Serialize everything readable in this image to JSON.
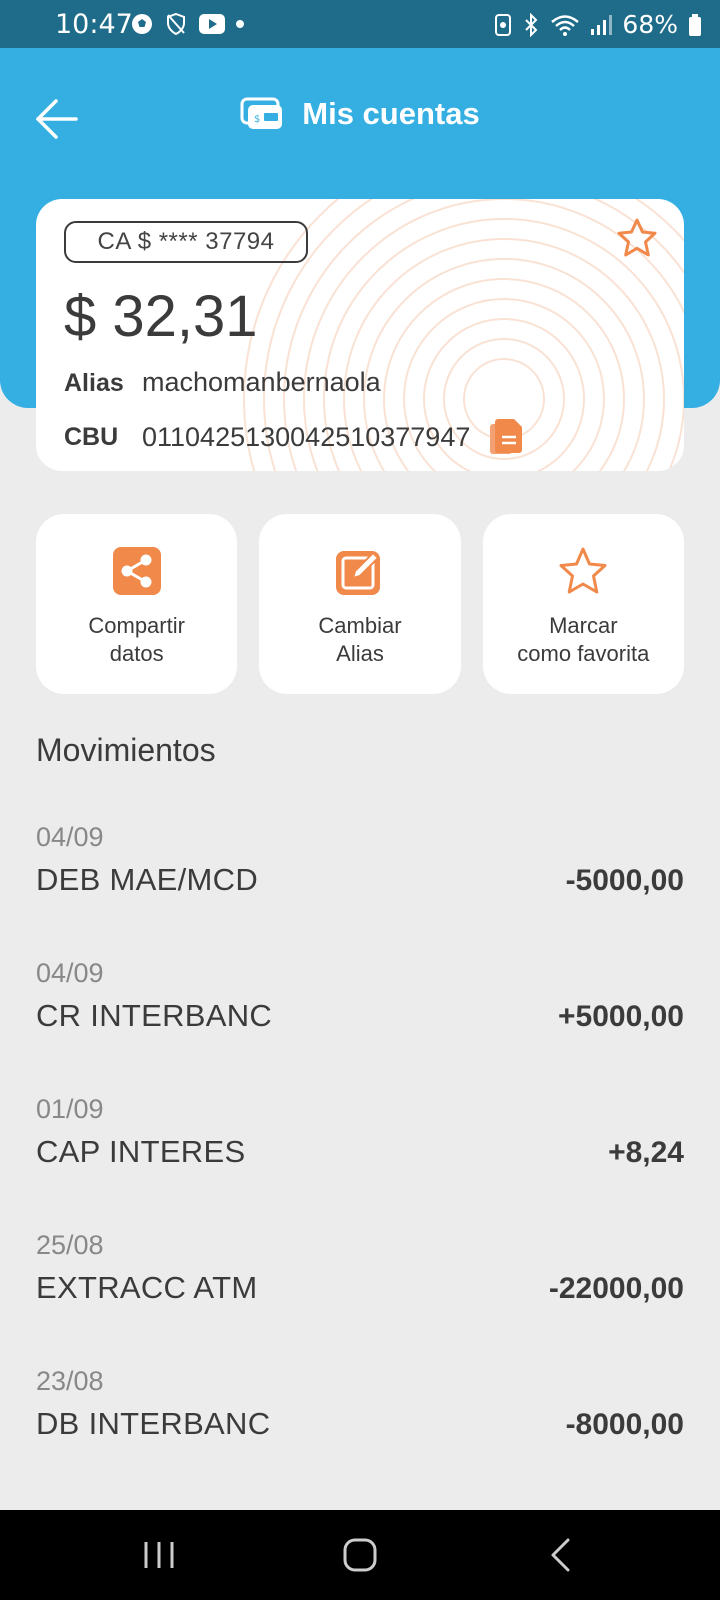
{
  "status_bar": {
    "time": "10:47",
    "battery": "68%",
    "left_icons": [
      "soccer-icon",
      "shield-icon",
      "youtube-icon",
      "dot-icon"
    ],
    "right_icons": [
      "nfc-icon",
      "bluetooth-icon",
      "wifi-icon",
      "signal-icon",
      "battery-icon"
    ]
  },
  "header": {
    "title": "Mis cuentas",
    "color": "#35afe2"
  },
  "account": {
    "number": "CA $ **** 37794",
    "balance": "$ 32,31",
    "alias_label": "Alias",
    "alias_value": "machomanbernaola",
    "cbu_label": "CBU",
    "cbu_value": "0110425130042510377947"
  },
  "actions": [
    {
      "label": "Compartir\ndatos",
      "icon": "share-icon"
    },
    {
      "label": "Cambiar\nAlias",
      "icon": "edit-icon"
    },
    {
      "label": "Marcar\ncomo favorita",
      "icon": "star-icon"
    }
  ],
  "accent_color": "#f0894a",
  "movements": {
    "title": "Movimientos",
    "items": [
      {
        "date": "04/09",
        "description": "DEB MAE/MCD",
        "amount": "-5000,00"
      },
      {
        "date": "04/09",
        "description": "CR INTERBANC",
        "amount": "+5000,00"
      },
      {
        "date": "01/09",
        "description": "CAP INTERES",
        "amount": "+8,24"
      },
      {
        "date": "25/08",
        "description": "EXTRACC ATM",
        "amount": "-22000,00"
      },
      {
        "date": "23/08",
        "description": "DB INTERBANC",
        "amount": "-8000,00"
      }
    ]
  }
}
